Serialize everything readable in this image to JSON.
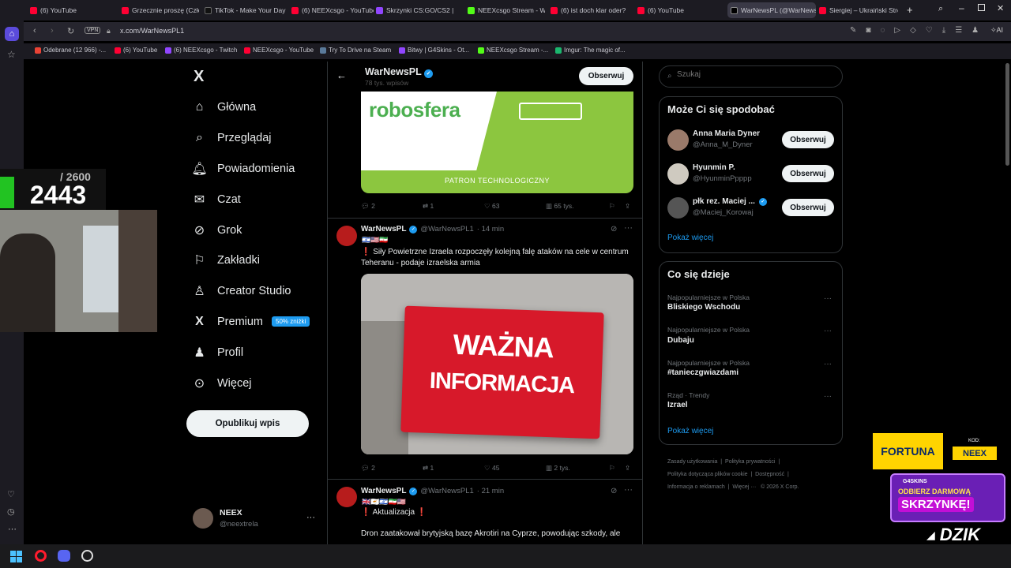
{
  "browser": {
    "tabs": [
      {
        "label": "(6) YouTube"
      },
      {
        "label": "Grzecznie proszę (Członk"
      },
      {
        "label": "TikTok - Make Your Day"
      },
      {
        "label": "(6) NEEXcsgo - YouTube"
      },
      {
        "label": "Skrzynki CS:GO/CS2 | G4"
      },
      {
        "label": "NEEXcsgo Stream - Wat"
      },
      {
        "label": "(6) ist doch klar oder? -"
      },
      {
        "label": "(6) YouTube"
      },
      {
        "label": "WarNewsPL (@WarNewsPL"
      },
      {
        "label": "Siergiej – Ukraiński Stre"
      }
    ],
    "url": "x.com/WarNewsPL1",
    "vpn": "VPN",
    "ai": "AI",
    "bookmarks": [
      {
        "label": "Odebrane (12 966) -..."
      },
      {
        "label": "(6) YouTube"
      },
      {
        "label": "(6) NEEXcsgo - Twitch"
      },
      {
        "label": "NEEXcsgo - YouTube"
      },
      {
        "label": "Try To Drive na Steam"
      },
      {
        "label": "Bitwy | G4Skins - Ot..."
      },
      {
        "label": "NEEXcsgo Stream -..."
      },
      {
        "label": "Imgur: The magic of..."
      }
    ]
  },
  "sidebar": {
    "logo": "X",
    "items": [
      {
        "label": "Główna"
      },
      {
        "label": "Przeglądaj"
      },
      {
        "label": "Powiadomienia"
      },
      {
        "label": "Czat"
      },
      {
        "label": "Grok"
      },
      {
        "label": "Zakładki"
      },
      {
        "label": "Creator Studio"
      },
      {
        "label": "Premium",
        "badge": "50% zniżki"
      },
      {
        "label": "Profil"
      },
      {
        "label": "Więcej"
      }
    ],
    "publish_label": "Opublikuj wpis",
    "account": {
      "name": "NEEX",
      "handle": "@neextrela"
    }
  },
  "header": {
    "name": "WarNewsPL",
    "sub": "78 tys. wpisów",
    "follow_label": "Obserwuj"
  },
  "feed": {
    "first_image": {
      "brand": "robosfera",
      "caption": "PATRON TECHNOLOGICZNY"
    },
    "first_actions": {
      "replies": "2",
      "reposts": "1",
      "likes": "63",
      "views": "65 tys."
    },
    "tweets": [
      {
        "name": "WarNewsPL",
        "handle": "@WarNewsPL1",
        "time": "· 14 min",
        "text": "❗️ Siły Powietrzne Izraela rozpoczęły kolejną falę ataków na cele w centrum Teheranu - podaje izraelska armia",
        "image_line1": "WAŻNA",
        "image_line2": "INFORMACJA",
        "replies": "2",
        "reposts": "1",
        "likes": "45",
        "views": "2 tys."
      },
      {
        "name": "WarNewsPL",
        "handle": "@WarNewsPL1",
        "time": "· 21 min",
        "update": "❗️ Aktualizacja ❗️",
        "text": "Dron zaatakował brytyjską bazę Akrotiri na Cyprze, powodując szkody, ale"
      }
    ]
  },
  "right": {
    "search_placeholder": "Szukaj",
    "who_title": "Może Ci się spodobać",
    "who": [
      {
        "name": "Anna Maria Dyner",
        "handle": "@Anna_M_Dyner"
      },
      {
        "name": "Hyunmin P.",
        "handle": "@HyunminPpppp"
      },
      {
        "name": "płk rez. Maciej ...",
        "handle": "@Maciej_Korowaj"
      }
    ],
    "follow_label": "Obserwuj",
    "show_more": "Pokaż więcej",
    "trends_title": "Co się dzieje",
    "trends": [
      {
        "context": "Najpopularniejsze w Polska",
        "topic": "Bliskiego Wschodu"
      },
      {
        "context": "Najpopularniejsze w Polska",
        "topic": "Dubaju"
      },
      {
        "context": "Najpopularniejsze w Polska",
        "topic": "#tanieczgwiazdami"
      },
      {
        "context": "Rząd · Trendy",
        "topic": "Izrael"
      }
    ],
    "footer": [
      "Zasady użytkowania",
      "Polityka prywatności",
      "Polityka dotycząca plików cookie",
      "Dostępność",
      "Informacja o reklamach",
      "Więcej ···",
      "© 2026 X Corp."
    ]
  },
  "overlay": {
    "counter_total": "/ 2600",
    "counter_value": "2443",
    "fortuna": "FORTUNA",
    "kod_label": "KOD:",
    "kod": "NEEX",
    "g4_brand": "G4SKINS",
    "g4_line1": "ODBIERZ DARMOWĄ",
    "g4_line2": "SKRZYNKĘ!",
    "dzik": "DZIK"
  },
  "colors": {
    "accent": "#1d9bf0",
    "brand_green": "#8cc63f",
    "sign_red": "#d7192a"
  }
}
